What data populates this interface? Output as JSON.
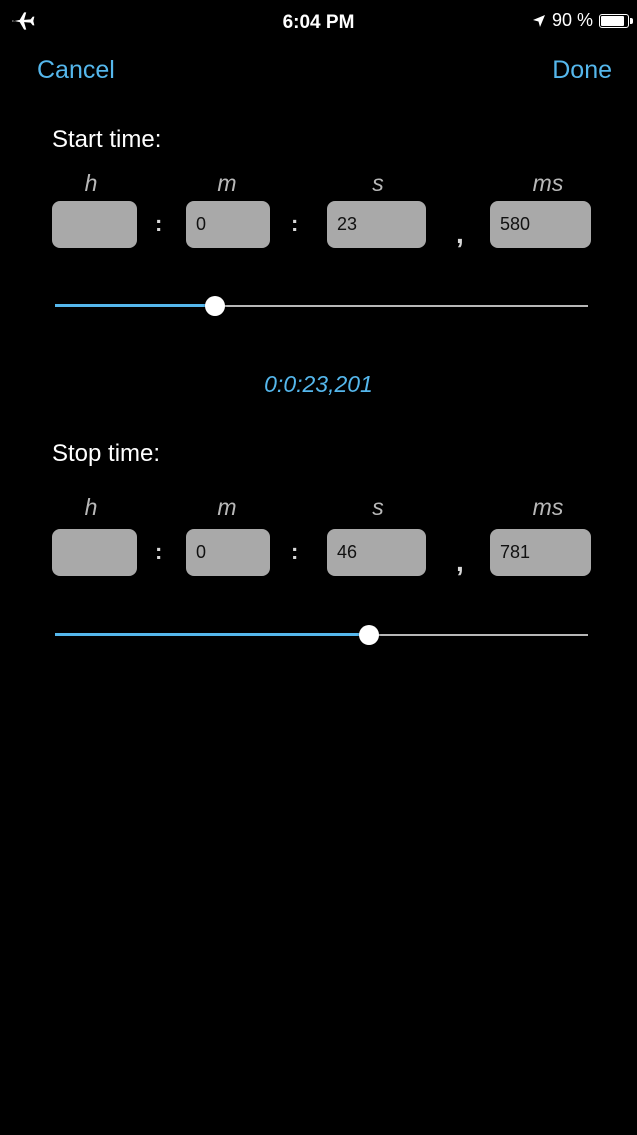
{
  "status_bar": {
    "time": "6:04 PM",
    "battery_percent": "90 %",
    "battery_level": 0.9,
    "icons": [
      "airplane-icon",
      "location-arrow-icon",
      "battery-icon"
    ]
  },
  "nav": {
    "cancel_label": "Cancel",
    "done_label": "Done",
    "accent_color": "#55b7ec"
  },
  "start": {
    "label": "Start time:",
    "units": {
      "h": "h",
      "m": "m",
      "s": "s",
      "ms": "ms"
    },
    "fields": {
      "h": "",
      "m": "0",
      "s": "23",
      "ms": "580"
    },
    "separator": ":",
    "comma": ",",
    "slider_value": 0.3
  },
  "duration": "0:0:23,201",
  "stop": {
    "label": "Stop time:",
    "units": {
      "h": "h",
      "m": "m",
      "s": "s",
      "ms": "ms"
    },
    "fields": {
      "h": "",
      "m": "0",
      "s": "46",
      "ms": "781"
    },
    "separator": ":",
    "comma": ",",
    "slider_value": 0.59
  }
}
